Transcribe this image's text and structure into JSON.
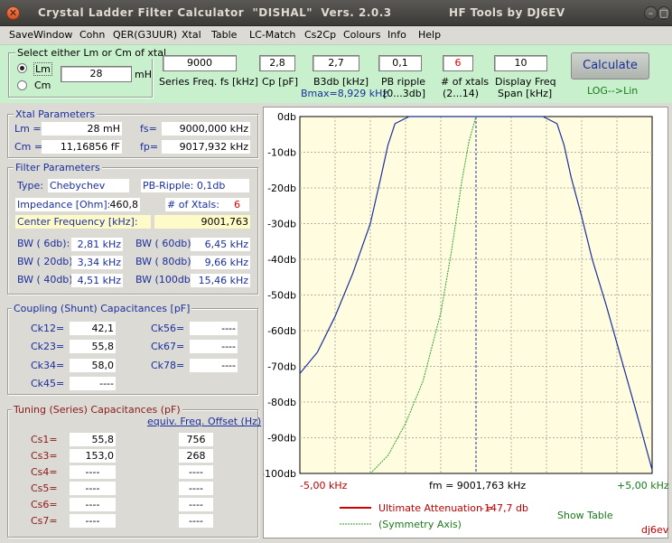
{
  "window": {
    "title": "Crystal Ladder Filter Calculator  \"DISHAL\"  Vers. 2.0.3",
    "brand": "HF Tools by DJ6EV",
    "min": "–",
    "max": "□",
    "close": "✕"
  },
  "menu": [
    "SaveWindow",
    "Cohn",
    "QER(G3UUR)",
    "Xtal",
    "Table",
    "LC-Match",
    "Cs2Cp",
    "Colours",
    "Info",
    "Help"
  ],
  "select": {
    "title": "Select either Lm or Cm of xtal",
    "lm_label": "Lm",
    "cm_label": "Cm",
    "value": "28",
    "unit": "mH",
    "selected": "Lm"
  },
  "params": {
    "series_freq": {
      "value": "9000",
      "label": "Series Freq. fs [kHz]"
    },
    "cp": {
      "value": "2,8",
      "label": "Cp [pF]"
    },
    "b3db": {
      "value": "2,7",
      "label": "B3db [kHz]",
      "sub": "Bmax=8,929 kHz"
    },
    "pb_ripple": {
      "value": "0,1",
      "label": "PB ripple",
      "sub": "[0...3db]"
    },
    "num_xtals": {
      "value": "6",
      "label": "# of xtals",
      "sub": "(2...14)"
    },
    "display_span": {
      "value": "10",
      "label": "Display Freq",
      "sub": "Span [kHz]"
    }
  },
  "calculate": {
    "label": "Calculate",
    "mode": "LOG-->Lin"
  },
  "xtal": {
    "title": "Xtal Parameters",
    "lm_label": "Lm =",
    "lm": "28 mH",
    "fs_label": "fs=",
    "fs": "9000,000 kHz",
    "cm_label": "Cm =",
    "cm": "11,16856  fF",
    "fp_label": "fp=",
    "fp": "9017,932 kHz"
  },
  "filter": {
    "title": "Filter Parameters",
    "type_label": "Type:",
    "type": "Chebychev",
    "ripple": "PB-Ripple: 0,1db",
    "imp_label": "Impedance [Ohm]:",
    "imp": "460,8",
    "nx_label": "# of Xtals:",
    "nx": "6",
    "cf_label": "Center Frequency [kHz]:",
    "cf": "9001,763",
    "bw": [
      {
        "l1": "BW (   6db):",
        "v1": "2,81 kHz",
        "l2": "BW ( 60db):",
        "v2": "6,45 kHz"
      },
      {
        "l1": "BW ( 20db):",
        "v1": "3,34 kHz",
        "l2": "BW ( 80db):",
        "v2": "9,66 kHz"
      },
      {
        "l1": "BW ( 40db):",
        "v1": "4,51 kHz",
        "l2": "BW (100db):",
        "v2": "15,46 kHz"
      }
    ]
  },
  "coupling": {
    "title": "Coupling (Shunt) Capacitances [pF]",
    "left": [
      {
        "n": "Ck12=",
        "v": "42,1"
      },
      {
        "n": "Ck23=",
        "v": "55,8"
      },
      {
        "n": "Ck34=",
        "v": "58,0"
      },
      {
        "n": "Ck45=",
        "v": "----"
      }
    ],
    "right": [
      {
        "n": "Ck56=",
        "v": "----"
      },
      {
        "n": "Ck67=",
        "v": "----"
      },
      {
        "n": "Ck78=",
        "v": "----"
      }
    ]
  },
  "tuning": {
    "title": "Tuning (Series) Capacitances (pF)",
    "link": "equiv. Freq. Offset (Hz)",
    "rows": [
      {
        "n": "Cs1=",
        "v": "55,8",
        "o": "756"
      },
      {
        "n": "Cs3=",
        "v": "153,0",
        "o": "268"
      },
      {
        "n": "Cs4=",
        "v": "----",
        "o": "----"
      },
      {
        "n": "Cs5=",
        "v": "----",
        "o": "----"
      },
      {
        "n": "Cs6=",
        "v": "----",
        "o": "----"
      },
      {
        "n": "Cs7=",
        "v": "----",
        "o": "----"
      }
    ]
  },
  "plot": {
    "ylabels": [
      "0db",
      "-10db",
      "-20db",
      "-30db",
      "-40db",
      "-50db",
      "-60db",
      "-70db",
      "-80db",
      "-90db",
      "-100db"
    ],
    "xleft": "-5,00 kHz",
    "xcenter": "fm = 9001,763 kHz",
    "xright": "+5,00 kHz",
    "ult_label": "Ultimate Attenuation =",
    "ult_value": "-147,7 db",
    "sym_label": "(Symmetry Axis)",
    "show_table": "Show Table",
    "sig": "dj6ev",
    "colors": {
      "bg": "#fffce0",
      "response": "#1a2f9e",
      "symmetry": "#2aa52a",
      "ultimate": "#d00000",
      "center": "#1a2f9e"
    }
  },
  "chart_data": {
    "type": "line",
    "xlim": [
      -5,
      5
    ],
    "ylim": [
      -100,
      0
    ],
    "xunits": "kHz offset from fm",
    "yunits": "db",
    "grid": true,
    "series": [
      {
        "values": [
          [
            -5,
            -72
          ],
          [
            -4.5,
            -66
          ],
          [
            -4,
            -56
          ],
          [
            -3.5,
            -44
          ],
          [
            -3,
            -30
          ],
          [
            -2.7,
            -17
          ],
          [
            -2.5,
            -8
          ],
          [
            -2.3,
            -2
          ],
          [
            -1.9,
            0
          ],
          [
            -1.4,
            0
          ],
          [
            1.4,
            0
          ],
          [
            1.9,
            0
          ],
          [
            2.3,
            -2
          ],
          [
            2.5,
            -8
          ],
          [
            2.7,
            -17
          ],
          [
            3,
            -28
          ],
          [
            3.3,
            -40
          ],
          [
            3.7,
            -53
          ],
          [
            4.1,
            -67
          ],
          [
            4.5,
            -81
          ],
          [
            5,
            -99
          ]
        ]
      },
      {
        "values": [
          [
            -3,
            -100
          ],
          [
            -2.5,
            -95
          ],
          [
            -2,
            -86
          ],
          [
            -1.5,
            -74
          ],
          [
            -1,
            -55
          ],
          [
            -0.7,
            -38
          ],
          [
            -0.4,
            -18
          ],
          [
            -0.2,
            -7
          ],
          [
            0,
            0
          ]
        ]
      }
    ]
  }
}
